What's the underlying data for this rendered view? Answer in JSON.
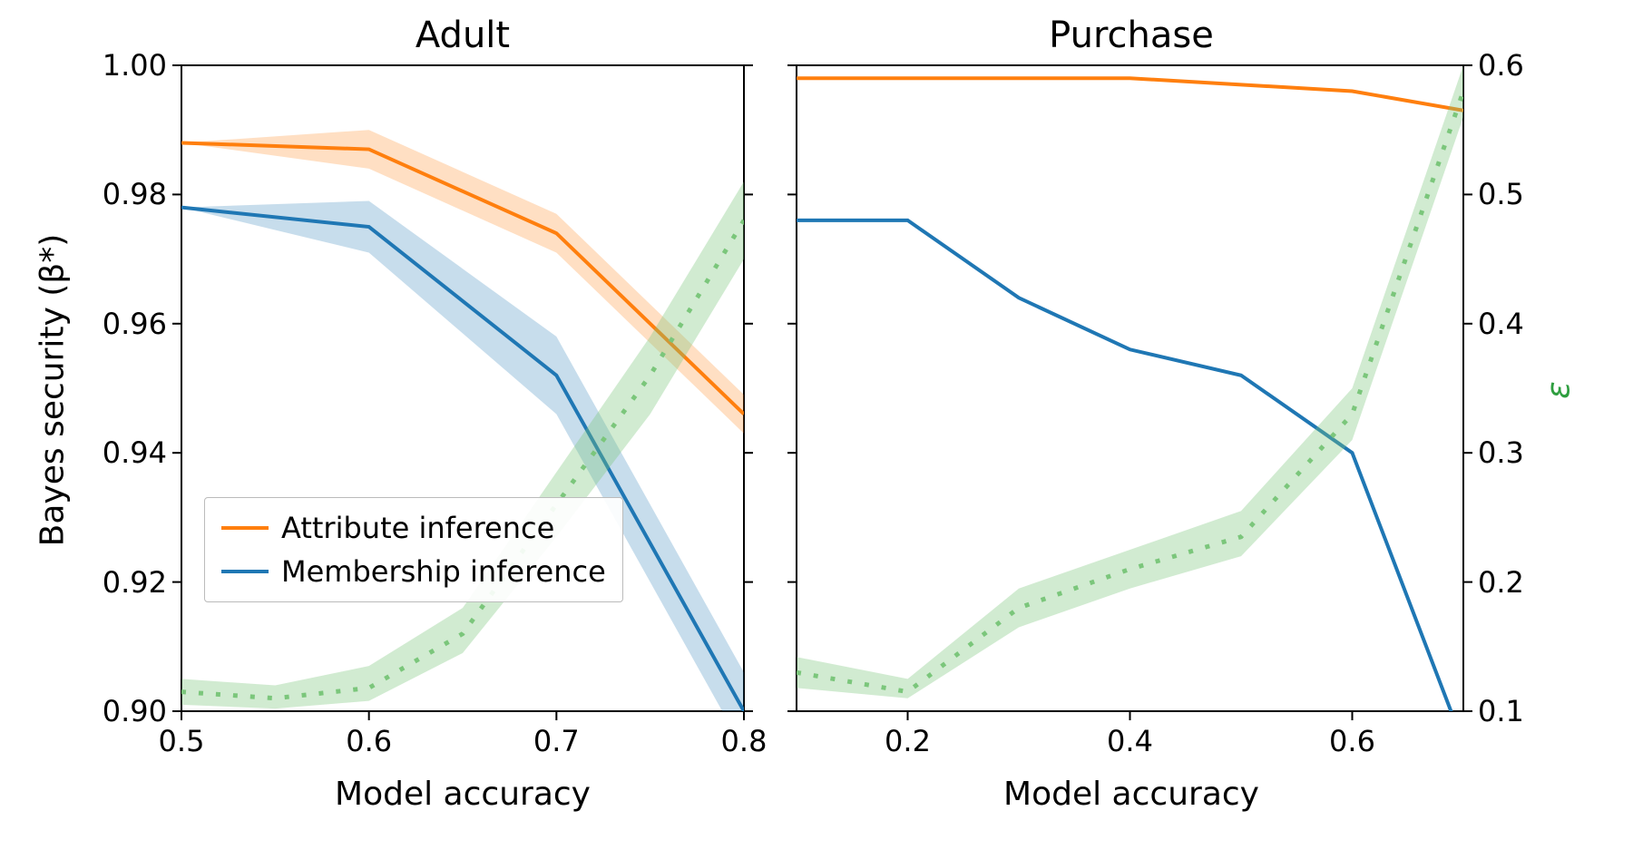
{
  "left": {
    "title": "Adult",
    "xlabel": "Model accuracy",
    "ylabel": "Bayes security (β*)",
    "xlim": [
      0.5,
      0.8
    ],
    "ylim_left": [
      0.9,
      1.0
    ],
    "ylim_right": [
      0.1,
      0.6
    ],
    "x_ticks": [
      0.5,
      0.6,
      0.7,
      0.8
    ],
    "y_ticks_left": [
      0.9,
      0.92,
      0.94,
      0.96,
      0.98,
      1.0
    ],
    "y_tick_labels_left": [
      "0.90",
      "0.92",
      "0.94",
      "0.96",
      "0.98",
      "1.00"
    ],
    "legend": {
      "items": [
        {
          "label": "Attribute inference",
          "color": "orange"
        },
        {
          "label": "Membership inference",
          "color": "blue"
        }
      ]
    }
  },
  "right": {
    "title": "Purchase",
    "xlabel": "Model accuracy",
    "ylabel_right": "ε",
    "xlim": [
      0.1,
      0.7
    ],
    "ylim_left": [
      0.9,
      1.0
    ],
    "ylim_right": [
      0.1,
      0.6
    ],
    "x_ticks": [
      0.2,
      0.4,
      0.6
    ],
    "y_ticks_right": [
      0.1,
      0.2,
      0.3,
      0.4,
      0.5,
      0.6
    ],
    "y_tick_labels_right": [
      "0.1",
      "0.2",
      "0.3",
      "0.4",
      "0.5",
      "0.6"
    ]
  },
  "colors": {
    "orange": "#ff7f0e",
    "blue": "#1f77b4",
    "green": "#7bc67b"
  },
  "chart_data": [
    {
      "type": "line",
      "panel": "Adult",
      "title": "Adult",
      "xlabel": "Model accuracy",
      "ylabel": "Bayes security (β*)",
      "ylabel_right": "ε",
      "xlim": [
        0.5,
        0.8
      ],
      "ylim": [
        0.9,
        1.0
      ],
      "ylim_right": [
        0.1,
        0.6
      ],
      "series": [
        {
          "name": "Attribute inference",
          "axis": "left",
          "color": "#ff7f0e",
          "style": "solid",
          "x": [
            0.5,
            0.6,
            0.7,
            0.8
          ],
          "y": [
            0.988,
            0.987,
            0.974,
            0.946
          ],
          "y_lo": [
            0.988,
            0.984,
            0.971,
            0.943
          ],
          "y_hi": [
            0.988,
            0.99,
            0.977,
            0.949
          ]
        },
        {
          "name": "Membership inference",
          "axis": "left",
          "color": "#1f77b4",
          "style": "solid",
          "x": [
            0.5,
            0.6,
            0.7,
            0.8
          ],
          "y": [
            0.978,
            0.975,
            0.952,
            0.9
          ],
          "y_lo": [
            0.978,
            0.971,
            0.946,
            0.894
          ],
          "y_hi": [
            0.978,
            0.979,
            0.958,
            0.906
          ]
        },
        {
          "name": "ε",
          "axis": "right",
          "color": "#7bc67b",
          "style": "dotted",
          "x": [
            0.5,
            0.55,
            0.6,
            0.65,
            0.7,
            0.75,
            0.8
          ],
          "y": [
            0.115,
            0.11,
            0.118,
            0.16,
            0.26,
            0.36,
            0.48
          ],
          "y_lo": [
            0.105,
            0.102,
            0.108,
            0.145,
            0.235,
            0.33,
            0.45
          ],
          "y_hi": [
            0.125,
            0.12,
            0.135,
            0.18,
            0.285,
            0.39,
            0.51
          ]
        }
      ]
    },
    {
      "type": "line",
      "panel": "Purchase",
      "title": "Purchase",
      "xlabel": "Model accuracy",
      "ylabel": "Bayes security (β*)",
      "ylabel_right": "ε",
      "xlim": [
        0.1,
        0.7
      ],
      "ylim": [
        0.9,
        1.0
      ],
      "ylim_right": [
        0.1,
        0.6
      ],
      "series": [
        {
          "name": "Attribute inference",
          "axis": "left",
          "color": "#ff7f0e",
          "style": "solid",
          "x": [
            0.1,
            0.2,
            0.3,
            0.4,
            0.5,
            0.6,
            0.7
          ],
          "y": [
            0.998,
            0.998,
            0.998,
            0.998,
            0.997,
            0.996,
            0.993
          ]
        },
        {
          "name": "Membership inference",
          "axis": "left",
          "color": "#1f77b4",
          "style": "solid",
          "x": [
            0.1,
            0.2,
            0.3,
            0.4,
            0.5,
            0.6,
            0.7
          ],
          "y": [
            0.976,
            0.976,
            0.964,
            0.956,
            0.952,
            0.94,
            0.895
          ]
        },
        {
          "name": "ε",
          "axis": "right",
          "color": "#7bc67b",
          "style": "dotted",
          "x": [
            0.1,
            0.2,
            0.3,
            0.4,
            0.5,
            0.6,
            0.7
          ],
          "y": [
            0.13,
            0.115,
            0.18,
            0.21,
            0.235,
            0.33,
            0.58
          ],
          "y_lo": [
            0.118,
            0.11,
            0.165,
            0.195,
            0.22,
            0.31,
            0.56
          ],
          "y_hi": [
            0.142,
            0.125,
            0.195,
            0.225,
            0.255,
            0.35,
            0.6
          ]
        }
      ]
    }
  ]
}
